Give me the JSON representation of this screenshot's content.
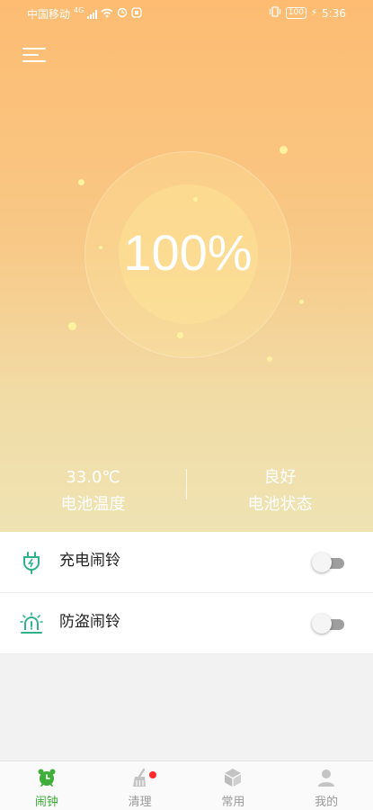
{
  "status_bar": {
    "carrier": "中国移动",
    "network": "4G",
    "battery_badge": "100",
    "time": "5:36"
  },
  "header": {
    "menu_icon": "hamburger-menu-icon"
  },
  "battery": {
    "percent_text": "100%"
  },
  "stats": {
    "temperature": {
      "value": "33.0℃",
      "label": "电池温度"
    },
    "status": {
      "value": "良好",
      "label": "电池状态"
    }
  },
  "alarms": [
    {
      "label": "充电闹铃",
      "icon": "charging-plug-icon",
      "enabled": false
    },
    {
      "label": "防盗闹铃",
      "icon": "alarm-siren-icon",
      "enabled": false
    }
  ],
  "tabs": [
    {
      "label": "闹钟",
      "icon": "alarm-clock-icon",
      "active": true
    },
    {
      "label": "清理",
      "icon": "broom-icon",
      "active": false,
      "badge": true
    },
    {
      "label": "常用",
      "icon": "cube-icon",
      "active": false
    },
    {
      "label": "我的",
      "icon": "user-icon",
      "active": false
    }
  ],
  "colors": {
    "accent_green": "#3fae3a",
    "icon_green": "#2fb28a",
    "badge_red": "#ff2b2b"
  }
}
